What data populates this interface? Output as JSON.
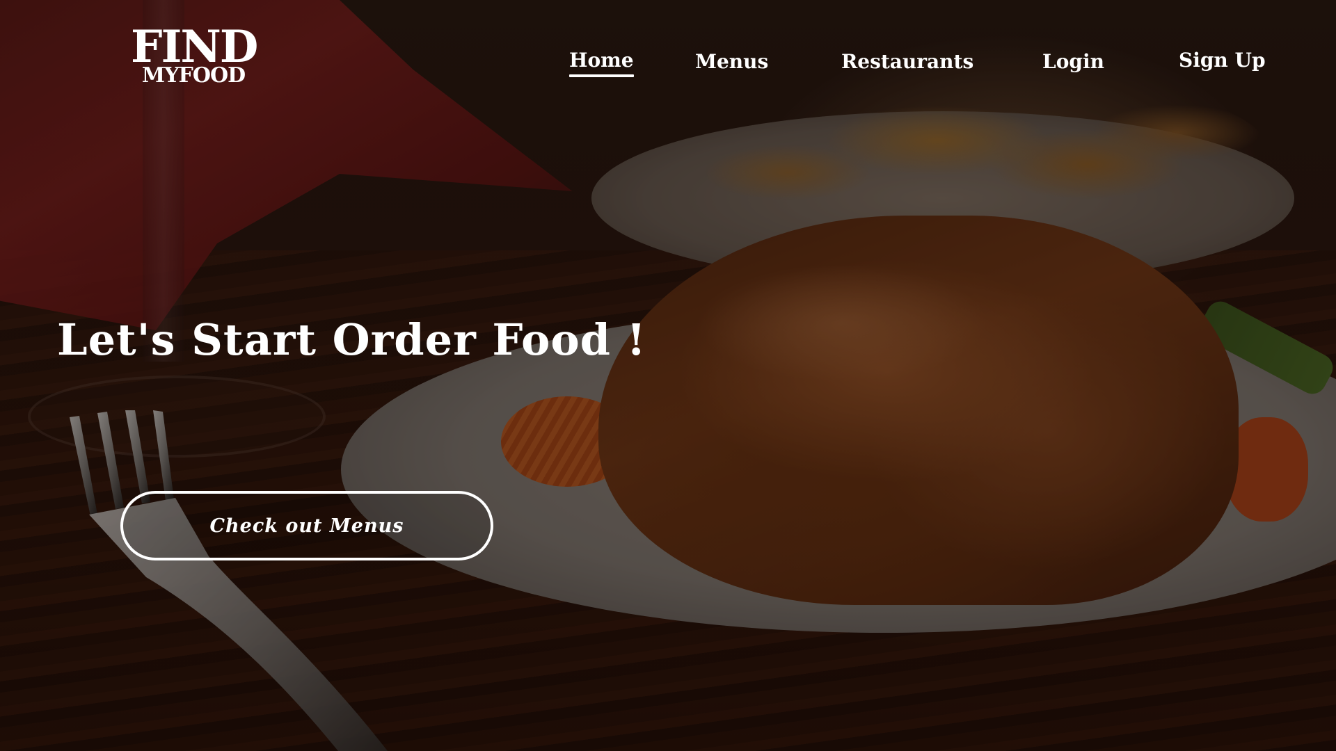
{
  "brand": {
    "logo_top": "FIND",
    "logo_bottom": "MYFOOD"
  },
  "nav": {
    "items": [
      {
        "label": "Home",
        "active": true
      },
      {
        "label": "Menus",
        "active": false
      },
      {
        "label": "Restaurants",
        "active": false
      },
      {
        "label": "Login",
        "active": false
      },
      {
        "label": "Sign Up",
        "active": false
      }
    ]
  },
  "hero": {
    "headline": "Let's Start Order Food !",
    "cta_label": "Check out Menus"
  },
  "colors": {
    "text": "#ffffff",
    "overlay": "#0a0402"
  }
}
